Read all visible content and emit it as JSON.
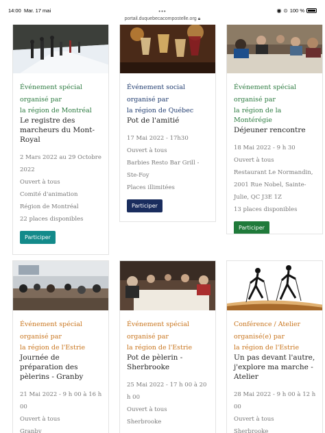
{
  "status_bar": {
    "time": "14:00",
    "date": "Mar. 17 mai",
    "dots": "•••",
    "url": "portail.duquebecacompostelle.org",
    "battery": "100 %"
  },
  "cards": [
    {
      "category": "Événement spécial organisé par",
      "region": "la région de Montréal",
      "title": "Le registre des marcheurs du Mont-Royal",
      "meta": [
        "2 Mars 2022 au 29 Octobre 2022",
        "Ouvert à tous",
        "Comité d'animation",
        "Région de Montréal",
        "22 places disponibles"
      ],
      "button": "Participer",
      "image": "snow-walkers"
    },
    {
      "category": "Événement social organisé par",
      "region": "la région de Québec",
      "title": "Pot de l'amitié",
      "meta": [
        "17 Mai 2022 - 17h30",
        "Ouvert à tous",
        "Barbies Resto Bar Grill - Ste-Foy",
        "Places illimitées"
      ],
      "button": "Participer",
      "image": "wine-glasses"
    },
    {
      "category": "Événement spécial organisé par",
      "region": "la région de la Montérégie",
      "title": "Déjeuner rencontre",
      "meta": [
        "18 Mai 2022 - 9 h 30",
        "Ouvert à tous",
        "Restaurant Le Normandin, 2001 Rue Nobel, Sainte-Julie, QC J3E 1Z",
        "13 places disponibles"
      ],
      "button": "Participer",
      "image": "restaurant-group"
    },
    {
      "category": "Événement spécial organisé par",
      "region": "la région de l'Estrie",
      "title": "Journée de préparation des pèlerins - Granby",
      "meta": [
        "21 Mai 2022 - 9 h 00 à 16 h 00",
        "Ouvert à tous",
        "Granby"
      ],
      "image": "conference-room"
    },
    {
      "category": "Événement spécial organisé par",
      "region": "la région de l'Estrie",
      "title": "Pot de pèlerin - Sherbrooke",
      "meta": [
        "25 Mai 2022 - 17 h 00 à 20 h 00",
        "Ouvert à tous",
        "Sherbrooke"
      ],
      "image": "dinner-table"
    },
    {
      "category": "Conférence / Atelier organisé(e) par",
      "region": "la région de l'Estrie",
      "title": "Un pas devant l'autre, j'explore ma marche - Atelier",
      "meta": [
        "28 Mai 2022 - 9 h 00 à 12 h 00",
        "Ouvert à tous",
        "Sherbrooke"
      ],
      "image": "nordic-walkers"
    }
  ]
}
